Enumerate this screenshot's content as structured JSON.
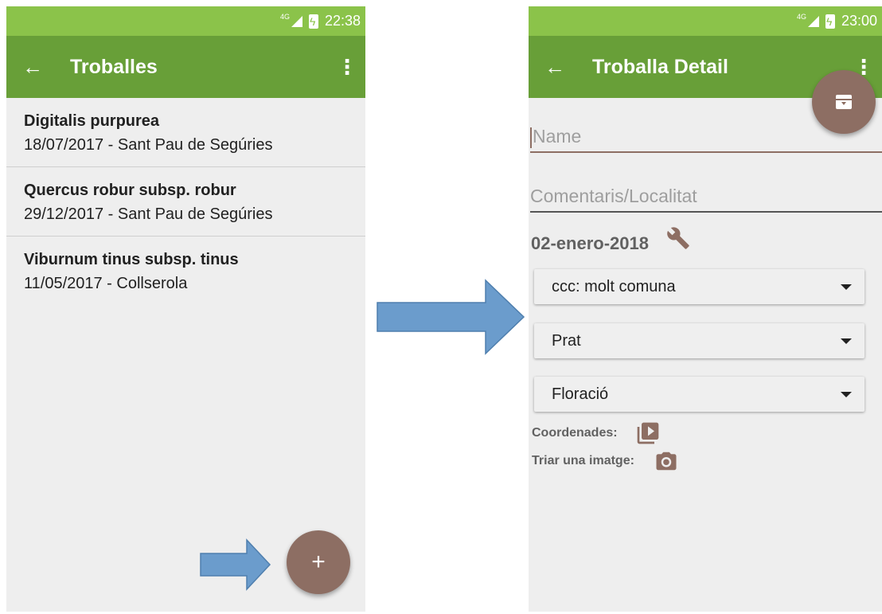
{
  "left_screen": {
    "status": {
      "network": "4G",
      "time": "22:38"
    },
    "toolbar": {
      "title": "Troballes"
    },
    "items": [
      {
        "title": "Digitalis purpurea",
        "subtitle": "18/07/2017 - Sant Pau de Segúries"
      },
      {
        "title": "Quercus robur subsp. robur",
        "subtitle": "29/12/2017 - Sant Pau de Segúries"
      },
      {
        "title": "Viburnum tinus subsp. tinus",
        "subtitle": "11/05/2017 - Collserola"
      }
    ],
    "fab_label": "+"
  },
  "right_screen": {
    "status": {
      "network": "4G",
      "time": "23:00"
    },
    "toolbar": {
      "title": "Troballa Detail"
    },
    "name_placeholder": "Name",
    "comment_placeholder": "Comentaris/Localitat",
    "date": "02-enero-2018",
    "dropdowns": {
      "abundance": "ccc: molt comuna",
      "habitat": "Prat",
      "phenology": "Floració"
    },
    "coordinates_label": "Coordenades:",
    "image_label": "Triar una imatge:"
  },
  "icons": [
    "back-arrow-icon",
    "overflow-menu-icon",
    "add-icon",
    "archive-icon",
    "wrench-icon",
    "photo-library-icon",
    "camera-icon",
    "dropdown-caret-icon"
  ],
  "colors": {
    "status_bar": "#8bc34a",
    "toolbar": "#689f38",
    "fab": "#8d6e63",
    "accent_icons": "#8d6e63",
    "annotation_arrow": "#6b9ccc"
  }
}
